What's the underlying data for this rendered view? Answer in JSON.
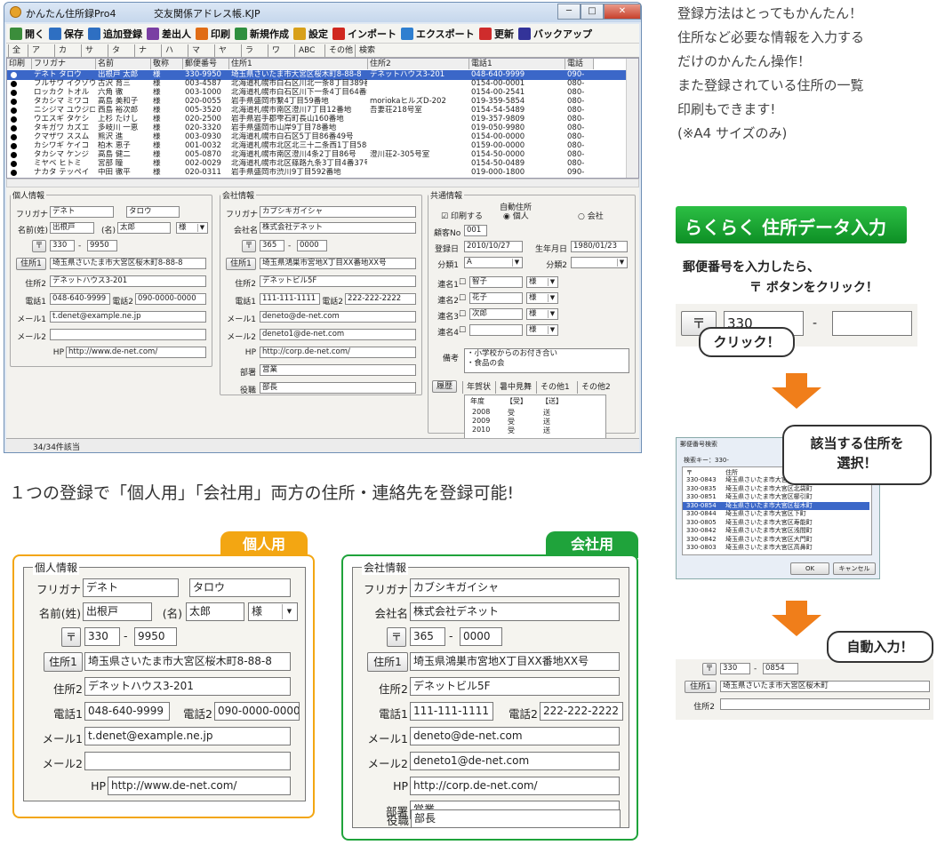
{
  "window": {
    "title": "かんたん住所録Pro4",
    "file": "交友関係アドレス帳.KJP",
    "min": "─",
    "max": "□",
    "close": "✕"
  },
  "toolbar": [
    "開く",
    "保存",
    "追加登録",
    "差出人",
    "印刷",
    "新規作成",
    "設定",
    "インポート",
    "エクスポート",
    "更新",
    "バックアップ"
  ],
  "toolbar_colors": [
    "#3b8d3b",
    "#2e6fc2",
    "#2e6fc2",
    "#7a3fa3",
    "#e06d16",
    "#2f8f3f",
    "#d8a019",
    "#d0281f",
    "#2f7fd0",
    "#cf2c2c",
    "#333399"
  ],
  "index_tabs": [
    "全て",
    "ア",
    "カ",
    "サ",
    "タ",
    "ナ",
    "ハ",
    "マ",
    "ヤ",
    "ラ",
    "ワ",
    "ABC",
    "その他",
    "検索"
  ],
  "grid": {
    "headers": [
      "印刷",
      "フリガナ",
      "名前",
      "敬称",
      "郵便番号",
      "住所1",
      "住所2",
      "電話1",
      "電話"
    ],
    "rows": [
      [
        "デネト タロウ",
        "出根戸 太郎",
        "様",
        "330-9950",
        "埼玉県さいたま市大宮区桜木町8-88-8",
        "デネットハウス3-201",
        "048-640-9999",
        "090-"
      ],
      [
        "フルサワ イクゾウ",
        "古沢 育三",
        "様",
        "003-4587",
        "北海道札幌市白石区川北一条8丁目389番地",
        "",
        "0154-00-0001",
        "080-"
      ],
      [
        "ロッカク トオル",
        "六角 徹",
        "様",
        "003-1000",
        "北海道札幌市白石区川下一条4丁目64番地",
        "",
        "0154-00-2541",
        "080-"
      ],
      [
        "タカシマ ミワコ",
        "高島 美和子",
        "様",
        "020-0055",
        "岩手県盛岡市繋4丁目59番地",
        "moriokaヒルズD-202",
        "019-359-5854",
        "080-"
      ],
      [
        "ニシジマ ユウジロウ",
        "西島 裕次郎",
        "様",
        "005-3520",
        "北海道札幌市南区澄川7丁目12番地",
        "吾妻荘218号室",
        "0154-54-5489",
        "080-"
      ],
      [
        "ウエスギ タケシ",
        "上杉 たけし",
        "様",
        "020-2500",
        "岩手県岩手郡雫石町長山160番地",
        "",
        "019-357-9809",
        "080-"
      ],
      [
        "タキガワ カズエ",
        "多岐川 一恵",
        "様",
        "020-3320",
        "岩手県盛岡市山岸9丁目78番地",
        "",
        "019-050-9980",
        "080-"
      ],
      [
        "クマザワ ススム",
        "熊沢 進",
        "様",
        "003-0930",
        "北海道札幌市白石区5丁目86番49号",
        "",
        "0154-00-0000",
        "080-"
      ],
      [
        "カシワギ ケイコ",
        "柏木 恵子",
        "様",
        "001-0032",
        "北海道札幌市北区北三十二条西1丁目58番4号",
        "",
        "0159-00-0000",
        "080-"
      ],
      [
        "タカシマ ケンジ",
        "高島 健二",
        "様",
        "005-0870",
        "北海道札幌市南区澄川4条2丁目86号",
        "澄川荘2-305号室",
        "0154-50-0000",
        "080-"
      ],
      [
        "ミヤベ ヒトミ",
        "宮部 瞳",
        "様",
        "002-0029",
        "北海道札幌市北区篠路九条3丁目4番37号",
        "",
        "0154-50-0489",
        "080-"
      ],
      [
        "ナカタ テッペイ",
        "中田 徹平",
        "様",
        "020-0311",
        "岩手県盛岡市渋川9丁目592番地",
        "",
        "019-000-1800",
        "090-"
      ]
    ]
  },
  "personal": {
    "legend": "個人情報",
    "furigana_label": "フリガナ",
    "furigana_sei": "デネト",
    "furigana_mei": "タロウ",
    "name_label": "名前(姓)",
    "sei": "出根戸",
    "mei_label": "(名)",
    "mei": "太郎",
    "honorific": "様",
    "zip_btn": "〒",
    "zip1": "330",
    "zip2": "9950",
    "addr1_btn": "住所1",
    "addr1": "埼玉県さいたま市大宮区桜木町8-88-8",
    "addr2_label": "住所2",
    "addr2": "デネットハウス3-201",
    "tel1_label": "電話1",
    "tel1": "048-640-9999",
    "tel2_label": "電話2",
    "tel2": "090-0000-0000",
    "mail1_label": "メール1",
    "mail1": "t.denet@example.ne.jp",
    "mail2_label": "メール2",
    "mail2": "",
    "hp_label": "HP",
    "hp": "http://www.de-net.com/"
  },
  "company": {
    "legend": "会社情報",
    "furigana_label": "フリガナ",
    "furigana": "カブシキガイシャ",
    "name_label": "会社名",
    "name": "株式会社デネット",
    "zip_btn": "〒",
    "zip1": "365",
    "zip2": "0000",
    "addr1_btn": "住所1",
    "addr1": "埼玉県鴻巣市宮地X丁目XX番地XX号",
    "addr2_label": "住所2",
    "addr2": "デネットビル5F",
    "tel1_label": "電話1",
    "tel1": "111-111-1111",
    "tel2_label": "電話2",
    "tel2": "222-222-2222",
    "mail1_label": "メール1",
    "mail1": "deneto@de-net.com",
    "mail2_label": "メール2",
    "mail2": "deneto1@de-net.com",
    "hp_label": "HP",
    "hp": "http://corp.de-net.com/",
    "dept_label": "部署",
    "dept": "営業",
    "role_label": "役職",
    "role": "部長"
  },
  "common": {
    "legend": "共通情報",
    "print_label": "印刷する",
    "auto_addr": "自動住所",
    "opt_personal": "個人",
    "opt_company": "会社",
    "customer_no_label": "顧客No",
    "customer_no": "001",
    "reg_date_label": "登録日",
    "reg_date": "2010/10/27",
    "birth_label": "生年月日",
    "birth": "1980/01/23",
    "cat1_label": "分類1",
    "cat1": "A",
    "cat2_label": "分類2",
    "cat2": "",
    "joint_label": "連名1",
    "joint": [
      "智子",
      "花子",
      "次郎",
      ""
    ],
    "joint_labels": [
      "連名1",
      "連名2",
      "連名3",
      "連名4"
    ],
    "joint_hon": [
      "様",
      "様",
      "様",
      "様"
    ],
    "note_label": "備考",
    "note": "・小学校からのお付き合い\n・食品の会",
    "history_btn": "履歴",
    "tabs": [
      "年賀状",
      "暑中見舞",
      "その他1",
      "その他2"
    ],
    "hist_headers": [
      "年度",
      "【受】",
      "【送】"
    ],
    "hist_rows": [
      [
        "2008",
        "受",
        "送"
      ],
      [
        "2009",
        "受",
        "送"
      ],
      [
        "2010",
        "受",
        "送"
      ]
    ]
  },
  "status": "34/34件該当",
  "right": {
    "lines": [
      "登録方法はとってもかんたん！",
      "住所など必要な情報を入力する",
      "だけのかんたん操作！",
      "また登録されている住所の一覧",
      "印刷もできます!",
      "(※A4 サイズのみ)"
    ],
    "banner": "らくらく 住所データ入力",
    "instr1": "郵便番号を入力したら、",
    "instr2": "〒 ボタンをクリック！",
    "zip_btn": "〒",
    "zip_val": "330",
    "click": "クリック！",
    "dlg_title": "郵便番号検索",
    "dlg_key": "検索キー：330-",
    "dlg_headers": [
      "〒",
      "住所"
    ],
    "dlg_rows": [
      [
        "330-0843",
        "埼玉県さいたま市大宮区吉敷町"
      ],
      [
        "330-0835",
        "埼玉県さいたま市大宮区北袋町"
      ],
      [
        "330-0851",
        "埼玉県さいたま市大宮区櫛引町"
      ],
      [
        "330-0854",
        "埼玉県さいたま市大宮区桜木町"
      ],
      [
        "330-0844",
        "埼玉県さいたま市大宮区下町"
      ],
      [
        "330-0805",
        "埼玉県さいたま市大宮区寿能町"
      ],
      [
        "330-0842",
        "埼玉県さいたま市大宮区浅間町"
      ],
      [
        "330-0842",
        "埼玉県さいたま市大宮区大門町"
      ],
      [
        "330-0803",
        "埼玉県さいたま市大宮区高鼻町"
      ]
    ],
    "dlg_ok": "OK",
    "dlg_cancel": "キャンセル",
    "select_bubble1": "該当する住所を",
    "select_bubble2": "選択！",
    "auto_bubble": "自動入力！",
    "res_zip1": "330",
    "res_zip2": "0854",
    "res_addr1_btn": "住所1",
    "res_addr1": "埼玉県さいたま市大宮区桜木町",
    "res_addr2_label": "住所2",
    "res_addr2": ""
  },
  "caption": "１つの登録で「個人用」「会社用」両方の住所・連絡先を登録可能!",
  "tag_personal": "個人用",
  "tag_company": "会社用",
  "colors": {
    "orange": "#f3a612",
    "green": "#1fa33b",
    "arrow": "#f07e1a",
    "select": "#3b67c8"
  }
}
